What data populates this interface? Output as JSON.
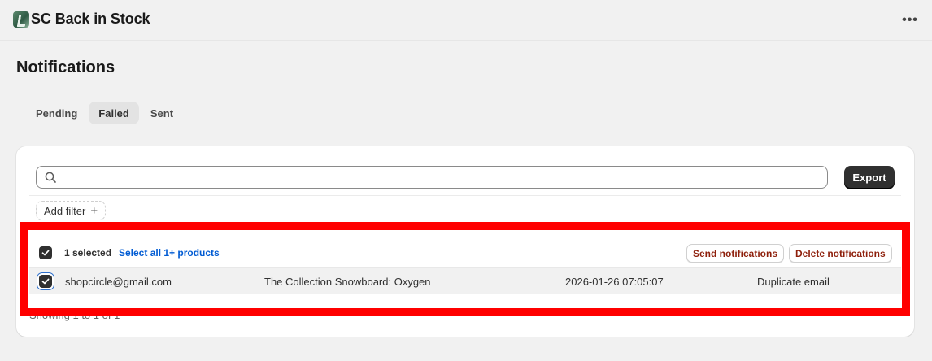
{
  "header": {
    "app_title": "SC Back in Stock",
    "app_icon": "app-logo-icon",
    "more_icon": "more-horizontal-icon",
    "more_label": "•••"
  },
  "page": {
    "title": "Notifications"
  },
  "tabs": [
    {
      "label": "Pending",
      "active": false
    },
    {
      "label": "Failed",
      "active": true
    },
    {
      "label": "Sent",
      "active": false
    }
  ],
  "search": {
    "value": "",
    "placeholder": ""
  },
  "toolbar": {
    "export_label": "Export"
  },
  "filters": {
    "add_filter_label": "Add filter",
    "plus": "+"
  },
  "bulk": {
    "selected_label": "1 selected",
    "select_all_label": "Select all 1+ products",
    "send_label": "Send notifications",
    "delete_label": "Delete notifications"
  },
  "rows": [
    {
      "checked": true,
      "email": "shopcircle@gmail.com",
      "product": "The Collection Snowboard: Oxygen",
      "date": "2026-01-26 07:05:07",
      "reason": "Duplicate email"
    }
  ],
  "footer": {
    "showing_text": "Showing 1 to 1 of 1"
  },
  "colors": {
    "accent_link": "#005bd3",
    "critical_text": "#8e1f0b",
    "primary_button": "#303030",
    "highlight_border": "#ff0000"
  }
}
